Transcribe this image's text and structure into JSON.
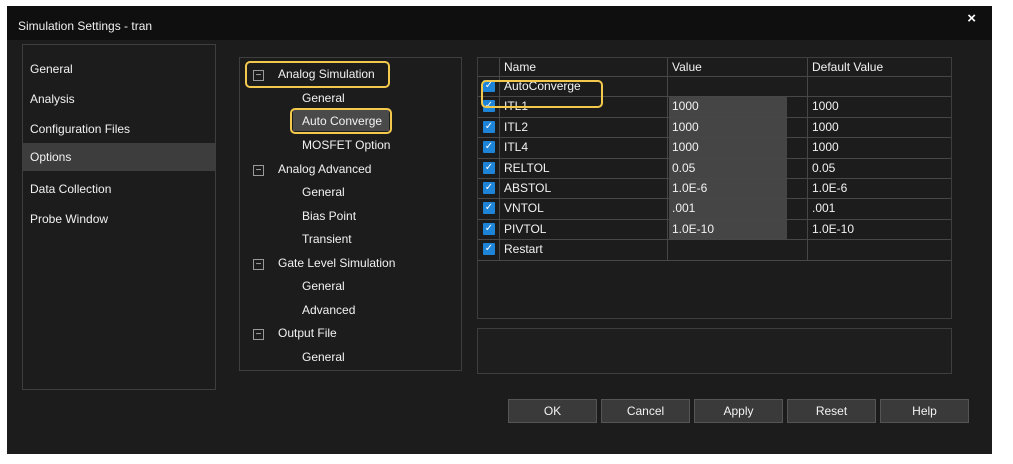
{
  "window": {
    "title": "Simulation Settings - tran",
    "close_glyph": "×"
  },
  "nav": {
    "items": [
      "General",
      "Analysis",
      "Configuration Files",
      "Options",
      "Data Collection",
      "Probe Window"
    ],
    "selected": "Options"
  },
  "tree": {
    "groups": [
      {
        "label": "Analog Simulation",
        "toggle": "−",
        "children": [
          "General",
          "Auto Converge",
          "MOSFET Option"
        ]
      },
      {
        "label": "Analog Advanced",
        "toggle": "−",
        "children": [
          "General",
          "Bias Point",
          "Transient"
        ]
      },
      {
        "label": "Gate Level Simulation",
        "toggle": "−",
        "children": [
          "General",
          "Advanced"
        ]
      },
      {
        "label": "Output File",
        "toggle": "−",
        "children": [
          "General"
        ]
      }
    ],
    "selected": "Auto Converge",
    "highlight_color": "#f2c94c"
  },
  "table": {
    "columns": [
      "Name",
      "Value",
      "Default Value"
    ],
    "rows": [
      {
        "name": "AutoConverge",
        "value": "",
        "default": "",
        "checked": true
      },
      {
        "name": "ITL1",
        "value": "1000",
        "default": "1000",
        "checked": true
      },
      {
        "name": "ITL2",
        "value": "1000",
        "default": "1000",
        "checked": true
      },
      {
        "name": "ITL4",
        "value": "1000",
        "default": "1000",
        "checked": true
      },
      {
        "name": "RELTOL",
        "value": "0.05",
        "default": "0.05",
        "checked": true
      },
      {
        "name": "ABSTOL",
        "value": "1.0E-6",
        "default": "1.0E-6",
        "checked": true
      },
      {
        "name": "VNTOL",
        "value": ".001",
        "default": ".001",
        "checked": true
      },
      {
        "name": "PIVTOL",
        "value": "1.0E-10",
        "default": "1.0E-10",
        "checked": true
      },
      {
        "name": "Restart",
        "value": "",
        "default": "",
        "checked": true
      }
    ],
    "checkbox_color": "#1e84d8",
    "check_glyph": "✓"
  },
  "buttons": {
    "ok": "OK",
    "cancel": "Cancel",
    "apply": "Apply",
    "reset": "Reset",
    "help": "Help"
  }
}
